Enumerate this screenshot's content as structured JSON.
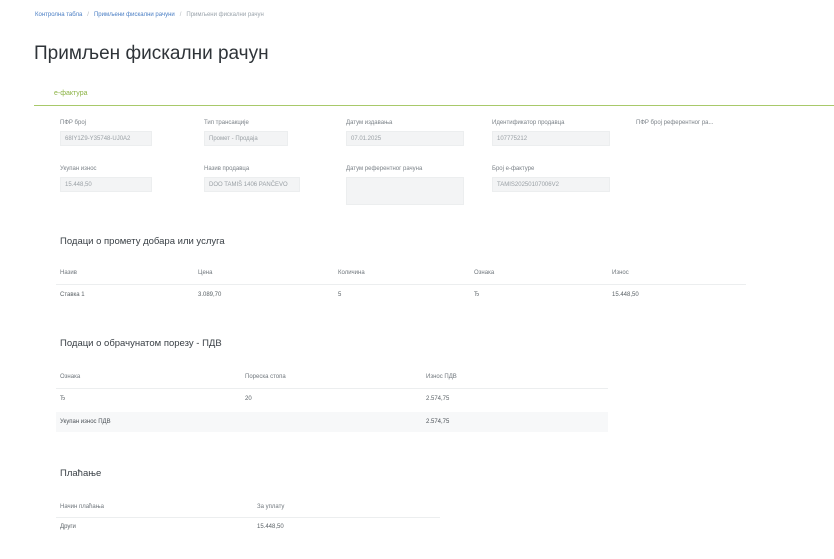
{
  "breadcrumb": [
    {
      "label": "Контролна табла"
    },
    {
      "label": "Примљени фискални рачуни"
    },
    {
      "label": "Примљени фискални рачун"
    }
  ],
  "page_title": "Примљен фискални рачун",
  "tabs": {
    "efaktura": "е-фактура"
  },
  "fields": {
    "pfr_broj": {
      "label": "ПФР број",
      "value": "68IY1Z9-Y35748-UJ0A2"
    },
    "tip_transakcije": {
      "label": "Тип трансакције",
      "value": "Промет - Продаја"
    },
    "datum_izdavanja": {
      "label": "Датум издавања",
      "value": "07.01.2025"
    },
    "identifikator_prodavca": {
      "label": "Идентификатор продавца",
      "value": "107775212"
    },
    "pfr_broj_referentnog": {
      "label": "ПФР број референтног ра..."
    },
    "ukupan_iznos": {
      "label": "Укупан износ",
      "value": "15.448,50"
    },
    "naziv_prodavca": {
      "label": "Назив продавца",
      "value": "DOO TAMIŠ 1406 PANČEVO"
    },
    "datum_referentnog": {
      "label": "Датум референтног рачуна"
    },
    "broj_efakture": {
      "label": "Број е-фактуре",
      "value": "TAMIS20250107006V2"
    }
  },
  "items_section": {
    "title": "Подаци о промету добара или услуга",
    "headers": [
      "Назив",
      "Цена",
      "Количина",
      "Ознака",
      "Износ"
    ],
    "rows": [
      [
        "Ставка 1",
        "3.089,70",
        "5",
        "Ђ",
        "15.448,50"
      ]
    ]
  },
  "tax_section": {
    "title": "Подаци о обрачунатом порезу - ПДВ",
    "headers": [
      "Ознака",
      "Пореска стопа",
      "Износ ПДВ"
    ],
    "rows": [
      [
        "Ђ",
        "20",
        "2.574,75"
      ]
    ],
    "total_label": "Укупан износ ПДВ",
    "total_value": "2.574,75"
  },
  "payment_section": {
    "title": "Плаћање",
    "headers": [
      "Начин плаћања",
      "За уплату"
    ],
    "rows": [
      [
        "Други",
        "15.448,50"
      ]
    ]
  }
}
